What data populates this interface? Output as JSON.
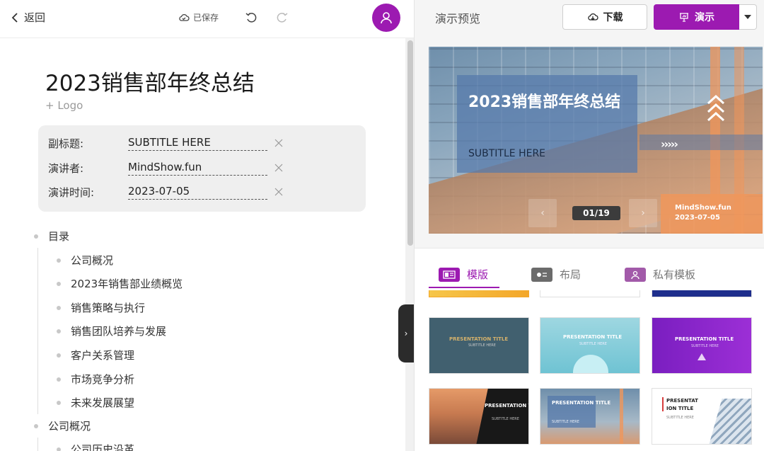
{
  "topbar": {
    "back_label": "返回",
    "saved_label": "已保存"
  },
  "document": {
    "title": "2023销售部年终总结",
    "add_logo": "+ Logo",
    "meta": [
      {
        "label": "副标题:",
        "value": "SUBTITLE HERE"
      },
      {
        "label": "演讲者:",
        "value": "MindShow.fun"
      },
      {
        "label": "演讲时间:",
        "value": "2023-07-05"
      }
    ],
    "outline": [
      "目录",
      "公司概况",
      "2023年销售部业绩概览",
      "销售策略与执行",
      "销售团队培养与发展",
      "客户关系管理",
      "市场竞争分析",
      "未来发展展望",
      "公司概况",
      "公司历史沿革"
    ]
  },
  "preview": {
    "title": "演示预览",
    "download_label": "下载",
    "present_label": "演示",
    "slide": {
      "title": "2023销售部年终总结",
      "subtitle": "SUBTITLE HERE",
      "author": "MindShow.fun",
      "date": "2023-07-05",
      "page_indicator": "01/19"
    },
    "tabs": [
      {
        "label": "模版",
        "active": true
      },
      {
        "label": "布局",
        "active": false
      },
      {
        "label": "私有模板",
        "active": false
      }
    ],
    "templates": [
      {
        "title": "PRESENTATION TITLE",
        "subtitle": "SUBTITLE HERE"
      },
      {
        "title": "PRESENTATION TITLE",
        "subtitle": "SUBTITLE HERE"
      },
      {
        "title": "PRESENTATION TITLE",
        "subtitle": "SUBTITLE HERE"
      },
      {
        "title": "PRESENTATION TITLE",
        "subtitle": "SUBTITLE HERE"
      },
      {
        "title": "PRESENTATION TITLE",
        "subtitle": "SUBTITLE HERE"
      },
      {
        "title": "PRESENTAT ION TITLE",
        "subtitle": "SUBTITLE HERE"
      }
    ]
  },
  "colors": {
    "accent": "#9c1ab1"
  }
}
